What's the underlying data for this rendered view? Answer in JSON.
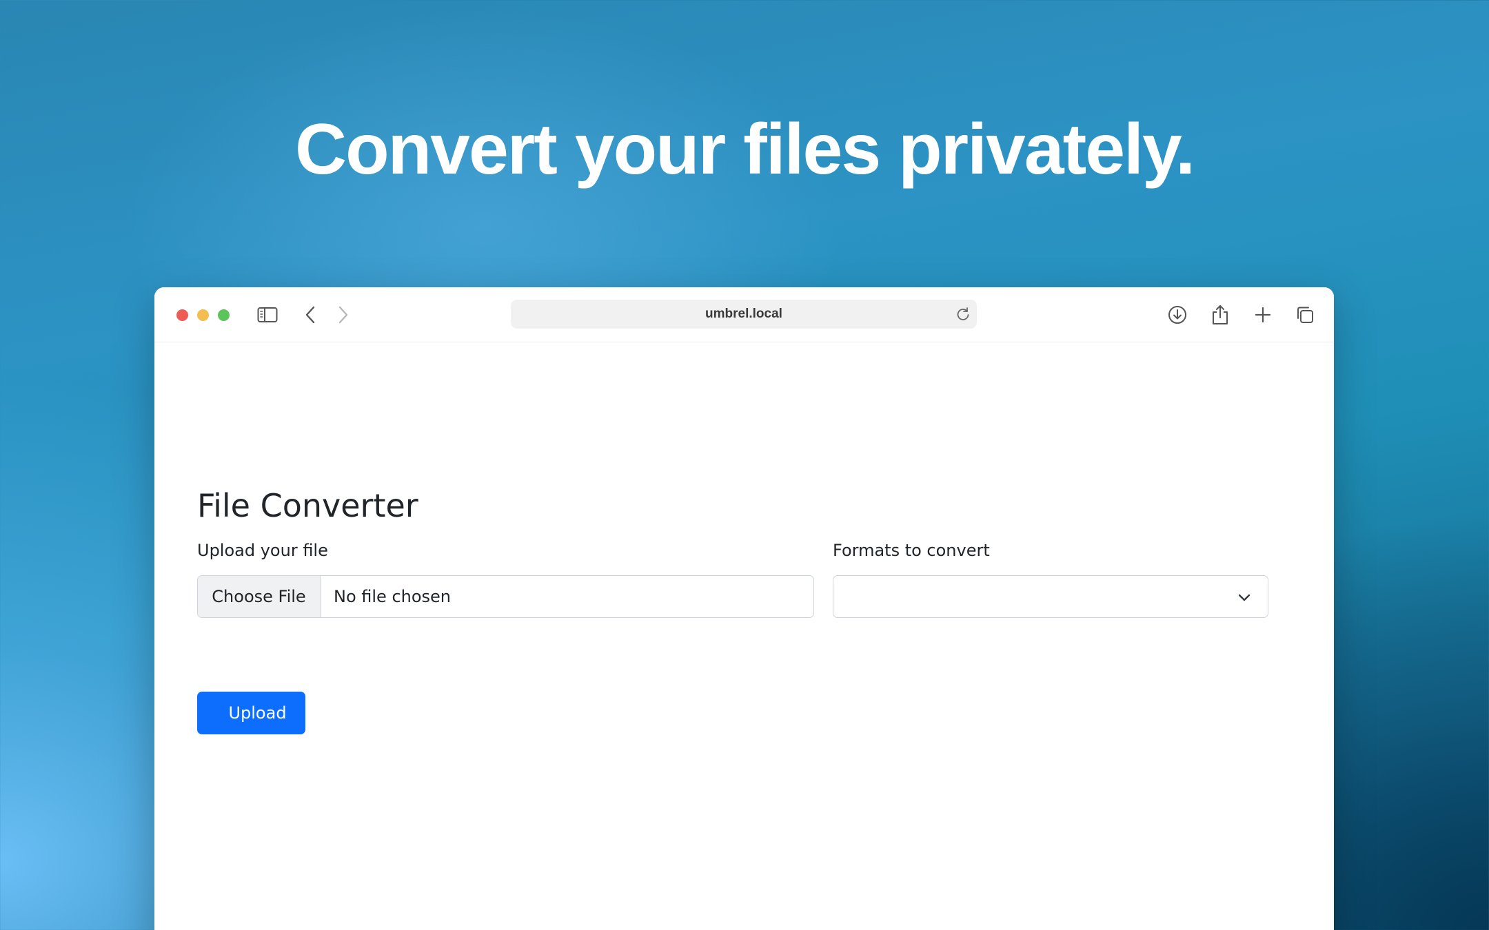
{
  "hero": {
    "headline": "Convert your files privately."
  },
  "browser": {
    "url": "umbrel.local",
    "icons": [
      "sidebar-icon",
      "back-icon",
      "forward-icon",
      "shield-icon",
      "reload-icon",
      "download-icon",
      "share-icon",
      "new-tab-icon",
      "tabs-overview-icon"
    ]
  },
  "app": {
    "title": "File Converter",
    "upload_label": "Upload your file",
    "choose_file": "Choose File",
    "file_status": "No file chosen",
    "formats_label": "Formats to convert",
    "formats_selected": "",
    "upload_button": "Upload",
    "accent_color": "#0d6efd"
  }
}
